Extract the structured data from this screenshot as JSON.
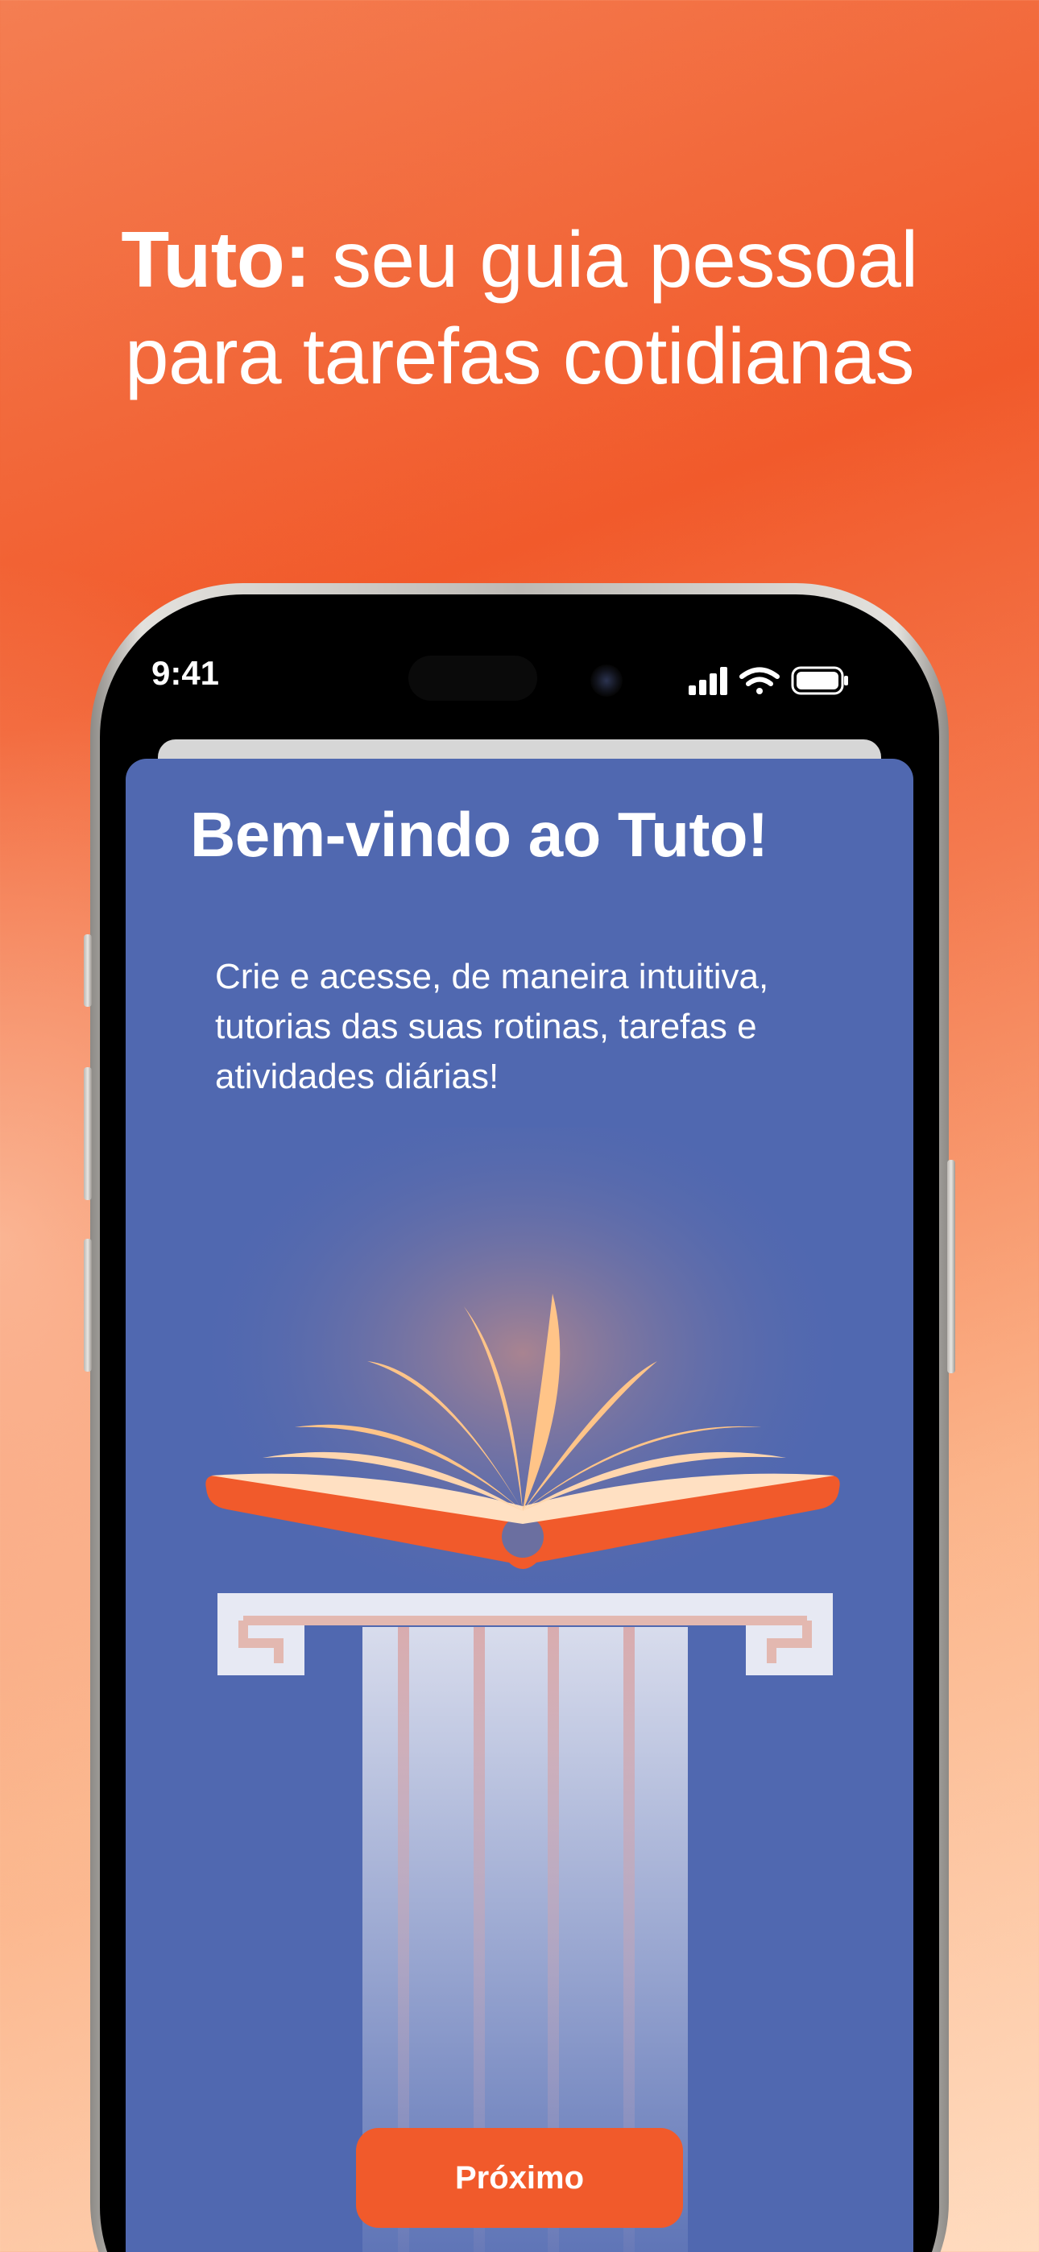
{
  "headline": {
    "brand": "Tuto:",
    "line1_rest": " seu guia pessoal",
    "line2": "para tarefas cotidianas"
  },
  "status_bar": {
    "time": "9:41",
    "icons": [
      "cellular-signal-icon",
      "wifi-icon",
      "battery-icon"
    ]
  },
  "welcome": {
    "title": "Bem-vindo ao Tuto!",
    "description": "Crie e acesse, de maneira intuitiva, tutorias das suas rotinas, tarefas e atividades diárias!",
    "illustration": "book-on-pillar-icon"
  },
  "actions": {
    "next_label": "Próximo"
  },
  "colors": {
    "accent": "#f15a2b",
    "sheet": "#5068b0",
    "book_pages": "#ffc488"
  }
}
